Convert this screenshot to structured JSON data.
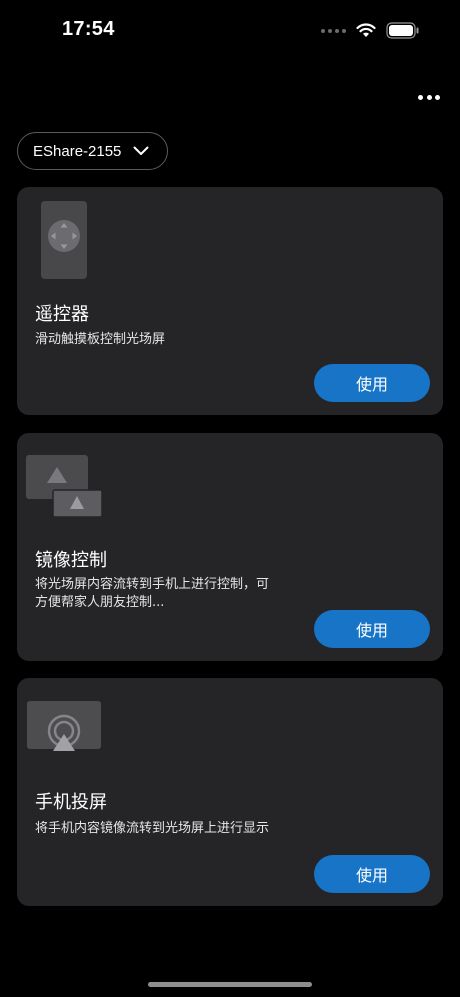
{
  "status_bar": {
    "time": "17:54"
  },
  "device_selector": {
    "label": "EShare-2155"
  },
  "cards": [
    {
      "title": "遥控器",
      "description": "滑动触摸板控制光场屏",
      "button": "使用"
    },
    {
      "title": "镜像控制",
      "description": "将光场屏内容流转到手机上进行控制，可方便帮家人朋友控制...",
      "button": "使用"
    },
    {
      "title": "手机投屏",
      "description": "将手机内容镜像流转到光场屏上进行显示",
      "button": "使用"
    }
  ],
  "colors": {
    "background": "#000000",
    "card": "#252527",
    "accent": "#1774c7"
  },
  "icons": [
    "signal-dots-icon",
    "wifi-icon",
    "battery-icon",
    "more-icon",
    "chevron-down-icon",
    "remote-control-icon",
    "mirror-control-icon",
    "screen-cast-icon"
  ]
}
